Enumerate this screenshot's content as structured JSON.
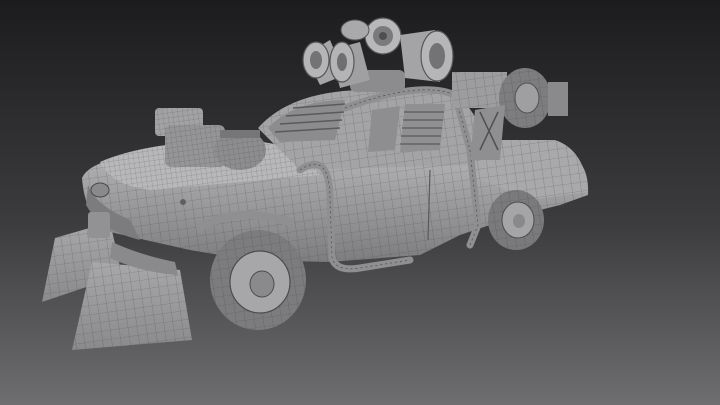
{
  "viewport": {
    "background_top": "#1c1c1e",
    "background_bottom": "#6e6e70",
    "model_base_color": "#9a9a9c",
    "wireframe_color": "#3f3f42",
    "wireframe_opacity": 0.45
  },
  "scene": {
    "subject": "car-with-speakers",
    "render_mode": "wireframe-on-shaded"
  }
}
